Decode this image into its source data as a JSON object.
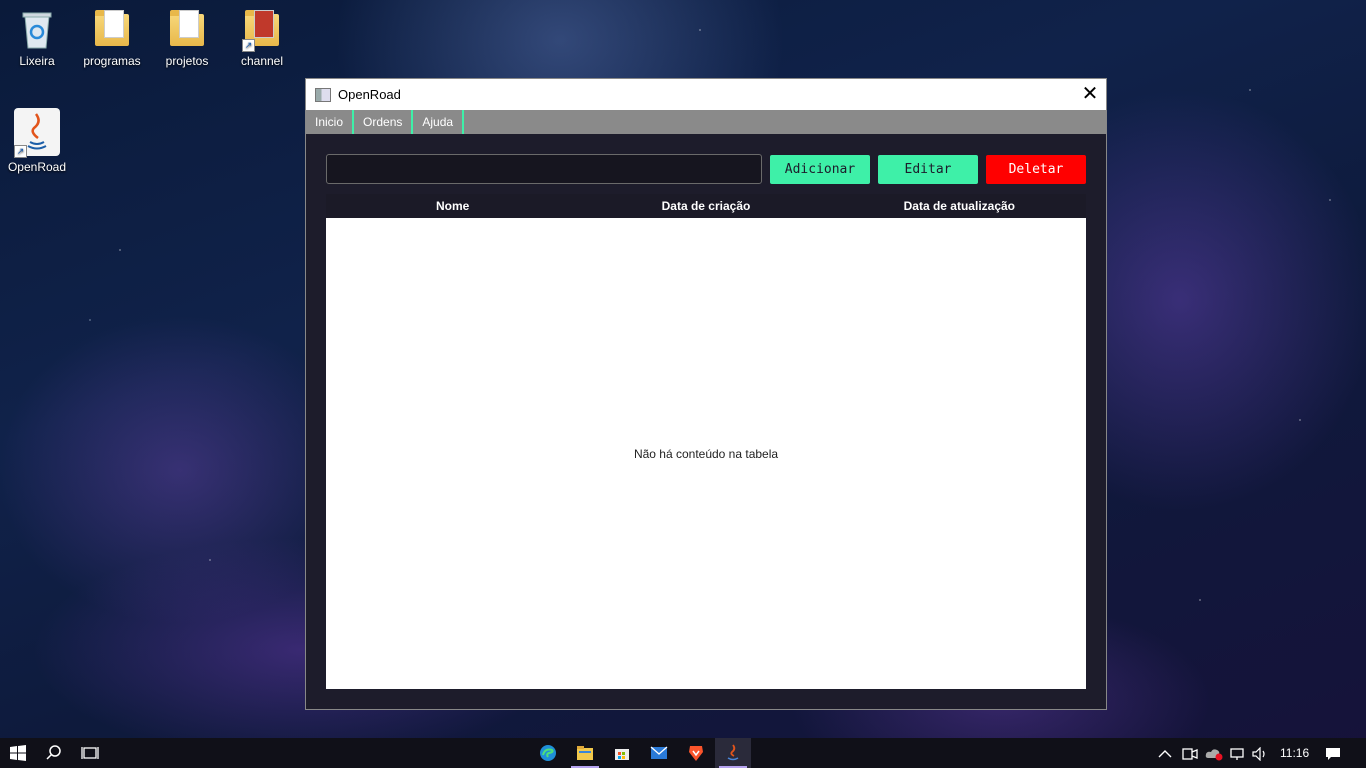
{
  "desktop": {
    "icons": [
      {
        "label": "Lixeira"
      },
      {
        "label": "programas"
      },
      {
        "label": "projetos"
      },
      {
        "label": "channel"
      },
      {
        "label": "OpenRoad"
      }
    ]
  },
  "window": {
    "title": "OpenRoad",
    "close_glyph": "✕",
    "menu": [
      "Inicio",
      "Ordens",
      "Ajuda"
    ],
    "search": {
      "value": "",
      "placeholder": ""
    },
    "buttons": {
      "add": "Adicionar",
      "edit": "Editar",
      "delete": "Deletar"
    },
    "table": {
      "columns": [
        "Nome",
        "Data de criação",
        "Data de atualização"
      ],
      "rows": [],
      "empty_message": "Não há conteúdo na tabela"
    }
  },
  "taskbar": {
    "clock": "11:16",
    "apps": [
      "start-icon",
      "search-icon",
      "task-view-icon",
      "edge-icon",
      "file-explorer-icon",
      "store-icon",
      "mail-icon",
      "brave-icon",
      "java-icon"
    ]
  },
  "colors": {
    "accent": "#3ef0a8",
    "danger": "#ff0000",
    "window_bg": "#1d1c2b",
    "menu_bg": "#8a8a8a"
  }
}
